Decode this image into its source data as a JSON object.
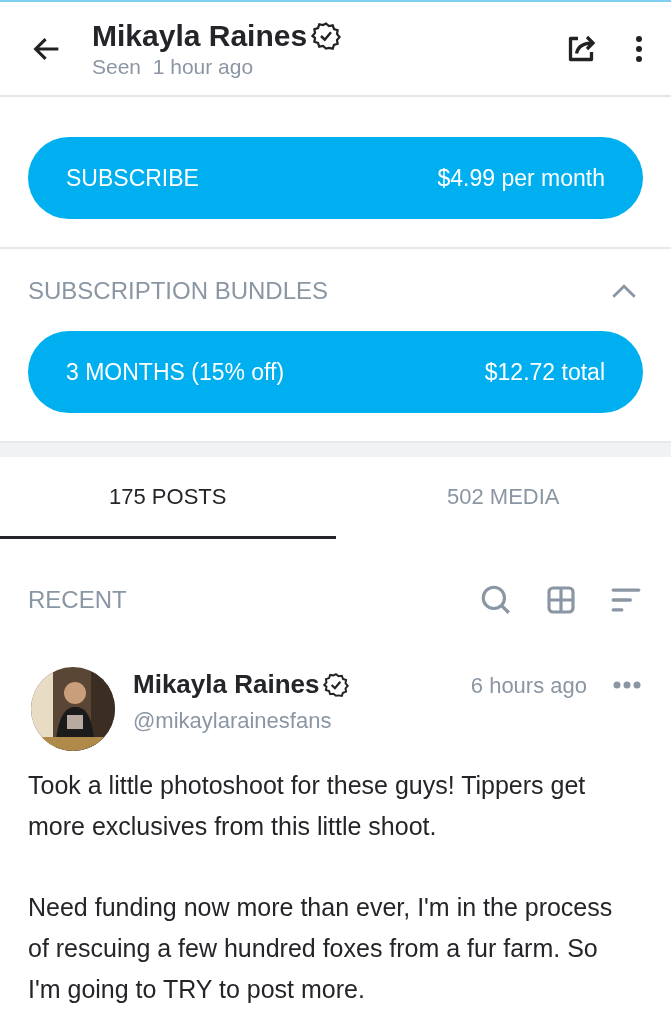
{
  "header": {
    "name": "Mikayla Raines",
    "verified": true,
    "status": "Seen  1 hour ago"
  },
  "subscription": {
    "button_label": "SUBSCRIBE",
    "price": "$4.99 per month"
  },
  "bundles": {
    "title": "SUBSCRIPTION BUNDLES",
    "expanded": true,
    "items": [
      {
        "label": "3 MONTHS (15% off)",
        "price": "$12.72 total"
      }
    ]
  },
  "tabs": [
    {
      "label": "175 POSTS",
      "selected": true
    },
    {
      "label": "502 MEDIA",
      "selected": false
    }
  ],
  "recent": {
    "title": "RECENT"
  },
  "post": {
    "name": "Mikayla Raines",
    "verified": true,
    "handle": "@mikaylarainesfans",
    "time": "6 hours ago",
    "paragraphs": [
      "Took a little photoshoot for these guys! Tippers get more exclusives from this little shoot.",
      "Need funding now more than ever, I'm in the process of rescuing a few hundred foxes from a fur farm. So I'm going to TRY to post more."
    ]
  }
}
